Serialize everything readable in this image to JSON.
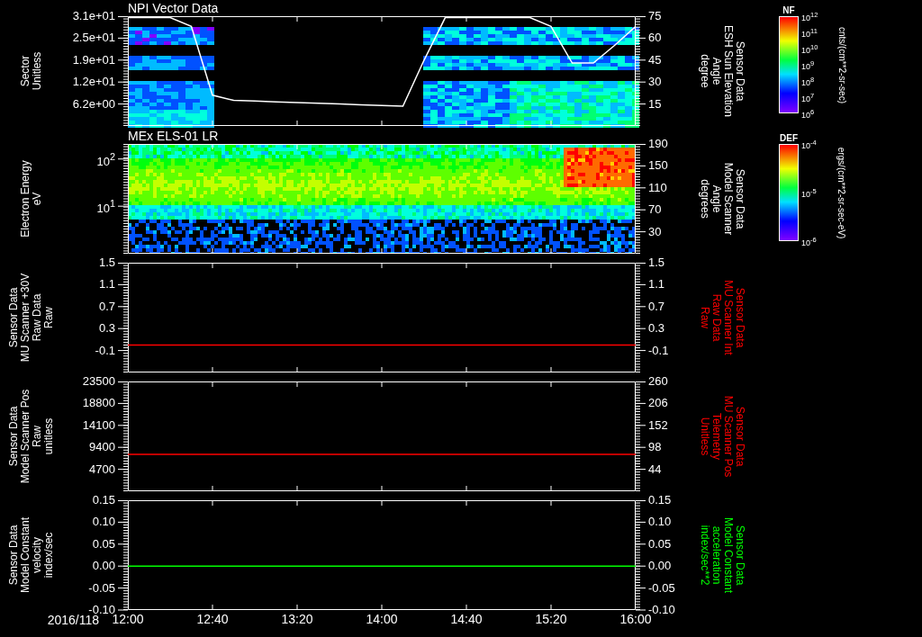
{
  "panels": [
    {
      "kind": "spectrogram",
      "title": "NPI Vector Data",
      "left_axis": {
        "label": [
          "Sector",
          "Unitless"
        ],
        "ticks": [
          "3.1e+01",
          "2.5e+01",
          "1.9e+01",
          "1.2e+01",
          "6.2e+00"
        ]
      },
      "chart_data": {
        "type": "line",
        "ylabel": "Sensor Data\nESH Sun Elevation\nAngle\ndegree",
        "ylim": [
          0,
          75
        ],
        "yticks": [
          {
            "value": 75,
            "label": "75"
          },
          {
            "value": 60,
            "label": "60"
          },
          {
            "value": 45,
            "label": "45"
          },
          {
            "value": 30,
            "label": "30"
          },
          {
            "value": 15,
            "label": "15"
          }
        ],
        "categories": [
          null,
          null,
          null,
          null,
          null,
          null,
          null,
          null,
          null,
          null,
          null,
          null,
          null,
          null,
          null,
          null,
          null,
          null,
          null,
          null,
          null,
          null,
          null,
          null,
          null
        ],
        "series": [
          {
            "color": "#ffffff",
            "values": [
              74,
              74,
              74,
              68,
              21,
              17.5,
              17,
              16.5,
              16,
              15.5,
              15,
              14.5,
              14,
              13.5,
              45,
              74,
              74,
              74,
              74,
              74,
              68,
              43,
              43,
              55,
              68
            ]
          }
        ]
      },
      "colorbar": {
        "title": "NF",
        "ticks": [
          "10$^{12}$",
          "10$^{11}$",
          "10$^{10}$",
          "10$^{9}$",
          "10$^{8}$",
          "10$^{7}$",
          "10$^{6}$"
        ],
        "units": "cnts/(cm**2-sr-sec)"
      }
    },
    {
      "kind": "spectrogram",
      "title": "MEx ELS-01 LR",
      "left_axis": {
        "label": [
          "Electron Energy",
          "eV"
        ],
        "ticks": [
          "10$^{2}$",
          "10$^{1}$"
        ]
      },
      "right_axis": {
        "label": [
          "Sensor Data",
          "Model Scanner",
          "Angle",
          "degrees"
        ],
        "ticks": [
          "190",
          "150",
          "110",
          "70",
          "30"
        ]
      },
      "colorbar": {
        "title": "DEF",
        "ticks": [
          "10$^{-4}$",
          "10$^{-5}$",
          "10$^{-6}$"
        ],
        "units": "ergs/(cm**2-sr-sec-eV)"
      }
    },
    {
      "kind": "line",
      "left_axis": {
        "label": [
          "Sensor Data",
          "MU Scanner +30V",
          "Raw Data",
          "Raw"
        ],
        "ticks": [
          "1.5",
          "1.1",
          "0.7",
          "0.3",
          "-0.1"
        ]
      },
      "chart_data": {
        "type": "line",
        "ylabel": "Sensor Data\nMU Scanner Int\nRaw Data\nRaw",
        "categories": [
          null,
          null
        ],
        "ylim": [
          -0.5,
          1.5
        ],
        "yticks": [
          {
            "value": 1.5,
            "label": "1.5"
          },
          {
            "value": 1.1,
            "label": "1.1"
          },
          {
            "value": 0.7,
            "label": "0.7"
          },
          {
            "value": 0.3,
            "label": "0.3"
          },
          {
            "value": -0.1,
            "label": "-0.1"
          }
        ],
        "series": [
          {
            "color": "#ff0000",
            "values": [
              0,
              0
            ]
          }
        ]
      }
    },
    {
      "kind": "line",
      "left_axis": {
        "label": [
          "Sensor Data",
          "Model Scanner Pos",
          "Raw",
          "unitless"
        ],
        "ticks": [
          "23500",
          "18800",
          "14100",
          "9400",
          "4700"
        ]
      },
      "chart_data": {
        "type": "line",
        "ylabel": "Sensor Data\nMU Scanner Pos\nTelemetry\nUnitless",
        "categories": [
          null,
          null
        ],
        "ylim": [
          -10,
          260
        ],
        "yticks": [
          {
            "value": 260,
            "label": "260"
          },
          {
            "value": 206,
            "label": "206"
          },
          {
            "value": 152,
            "label": "152"
          },
          {
            "value": 98,
            "label": "98"
          },
          {
            "value": 44,
            "label": "44"
          }
        ],
        "series": [
          {
            "color": "#ff0000",
            "values": [
              81,
              81
            ]
          }
        ]
      }
    },
    {
      "kind": "line",
      "left_axis": {
        "label": [
          "Sensor Data",
          "Model Constant",
          "velocity",
          "index/sec"
        ],
        "ticks": [
          "0.15",
          "0.10",
          "0.05",
          "0.00",
          "-0.05",
          "-0.10"
        ]
      },
      "chart_data": {
        "type": "line",
        "ylabel": "Sensor Data\nModel Constant\nacceleration\nindex/sec**2",
        "categories": [
          "12:00",
          "12:40",
          "13:20",
          "14:00",
          "14:40",
          "15:20",
          "16:00"
        ],
        "ylim": [
          -0.1,
          0.15
        ],
        "yticks": [
          {
            "value": 0.15,
            "label": "0.15"
          },
          {
            "value": 0.1,
            "label": "0.10"
          },
          {
            "value": 0.05,
            "label": "0.05"
          },
          {
            "value": 0,
            "label": "0.00"
          },
          {
            "value": -0.05,
            "label": "-0.05"
          },
          {
            "value": -0.1,
            "label": "-0.10"
          }
        ],
        "series": [
          {
            "color": "#00ff00",
            "values": [
              0,
              0,
              0,
              0,
              0,
              0,
              0
            ]
          }
        ]
      }
    }
  ],
  "date": "2016/118"
}
